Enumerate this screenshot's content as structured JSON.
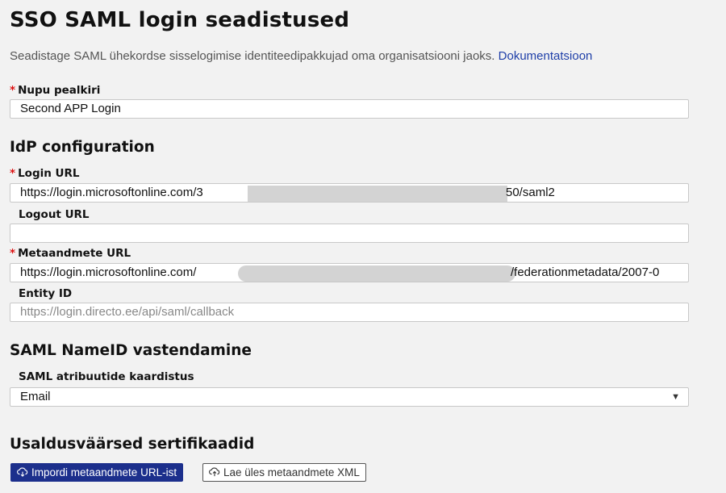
{
  "page": {
    "title": "SSO SAML login seadistused",
    "subtitle": "Seadistage SAML ühekordse sisselogimise identiteedipakkujad oma organisatsiooni jaoks.",
    "doc_link": "Dokumentatsioon"
  },
  "fields": {
    "button_title": {
      "label": "Nupu pealkiri",
      "value": "Second APP Login"
    },
    "login_url": {
      "label": "Login URL",
      "value_start": "https://login.microsoftonline.com/3",
      "value_end": "50/saml2"
    },
    "logout_url": {
      "label": "Logout URL",
      "value": ""
    },
    "metadata_url": {
      "label": "Metaandmete URL",
      "value_start": "https://login.microsoftonline.com/",
      "value_end": "/federationmetadata/2007-0"
    },
    "entity_id": {
      "label": "Entity ID",
      "placeholder": "https://login.directo.ee/api/saml/callback"
    }
  },
  "sections": {
    "idp": "IdP configuration",
    "nameid": "SAML NameID vastendamine",
    "certs": "Usaldusväärsed sertifikaadid"
  },
  "nameid": {
    "label": "SAML atribuutide kaardistus",
    "selected": "Email"
  },
  "buttons": {
    "import": "Impordi metaandmete URL-ist",
    "upload": "Lae üles metaandmete XML"
  },
  "colors": {
    "accent": "#1c2f8c",
    "link": "#1f3fa8",
    "required": "#dd1111"
  },
  "icons": {
    "import": "cloud-download-icon",
    "upload": "cloud-upload-icon",
    "select": "caret-down-icon"
  }
}
